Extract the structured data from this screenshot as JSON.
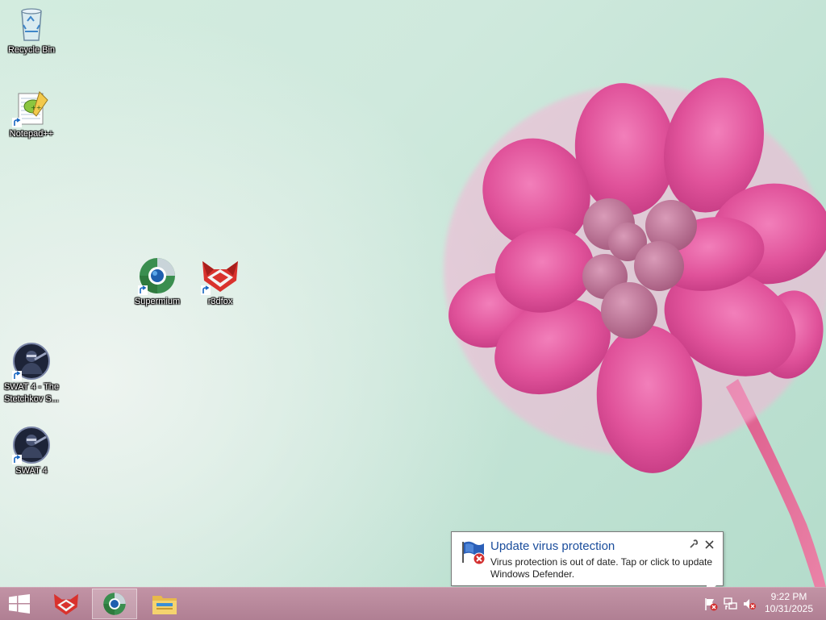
{
  "desktop": {
    "icons": [
      {
        "label": "Recycle Bin",
        "icon": "recycle-bin-icon"
      },
      {
        "label": "Notepad++",
        "icon": "notepad-plus-plus-icon"
      },
      {
        "label": "Supermium",
        "icon": "supermium-icon"
      },
      {
        "label": "r3dfox",
        "icon": "r3dfox-icon"
      },
      {
        "label": "SWAT 4 - The Stetchkov S...",
        "line1": "SWAT 4 - The",
        "line2": "Stetchkov S...",
        "icon": "swat4-expansion-icon"
      },
      {
        "label": "SWAT 4",
        "icon": "swat4-icon"
      }
    ]
  },
  "notification": {
    "title": "Update virus protection",
    "message": "Virus protection is out of date. Tap or click to update Windows Defender.",
    "icon": "windows-defender-flag-icon"
  },
  "taskbar": {
    "start_icon": "windows-start-icon",
    "pinned": [
      {
        "name": "r3dfox",
        "icon": "r3dfox-icon"
      },
      {
        "name": "Supermium",
        "icon": "supermium-icon",
        "active": true
      },
      {
        "name": "File Explorer",
        "icon": "file-explorer-icon"
      }
    ],
    "tray_icons": [
      "action-center-flag-icon",
      "network-icon",
      "volume-muted-icon"
    ],
    "clock": {
      "time": "9:22 PM",
      "date": "10/31/2025"
    }
  },
  "colors": {
    "taskbar": "#b58498",
    "notification_title": "#1a4d9c",
    "flower": "#e0529a"
  }
}
